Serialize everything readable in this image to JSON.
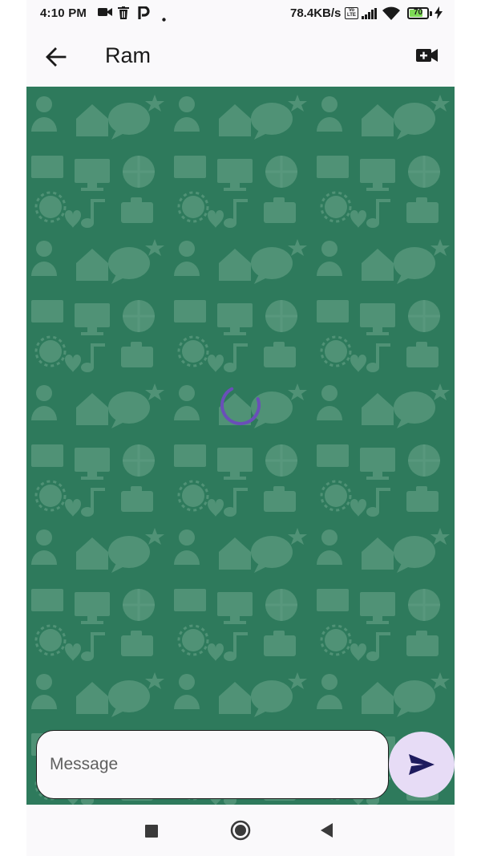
{
  "status_bar": {
    "time": "4:10 PM",
    "network_speed": "78.4KB/s",
    "volte": "Vo LTE",
    "battery": "70",
    "battery_level": 0.7,
    "icons": [
      "video-camera-icon",
      "delete-icon",
      "parking-app-icon",
      "dot-icon",
      "signal-icon",
      "wifi-icon",
      "battery-icon",
      "charging-icon"
    ]
  },
  "header": {
    "title": "Ram",
    "back_icon": "arrow-back-icon",
    "video_icon": "video-call-add-icon"
  },
  "chat": {
    "loading": true,
    "background_color": "#2e7a5c",
    "spinner_color": "#6a4fb8"
  },
  "composer": {
    "placeholder": "Message",
    "value": "",
    "send_icon": "send-icon",
    "send_bg": "#e7dcf6",
    "send_icon_color": "#1e1b5e"
  },
  "nav_bar": {
    "icons": [
      "recents-square-icon",
      "home-circle-icon",
      "back-triangle-icon"
    ]
  }
}
